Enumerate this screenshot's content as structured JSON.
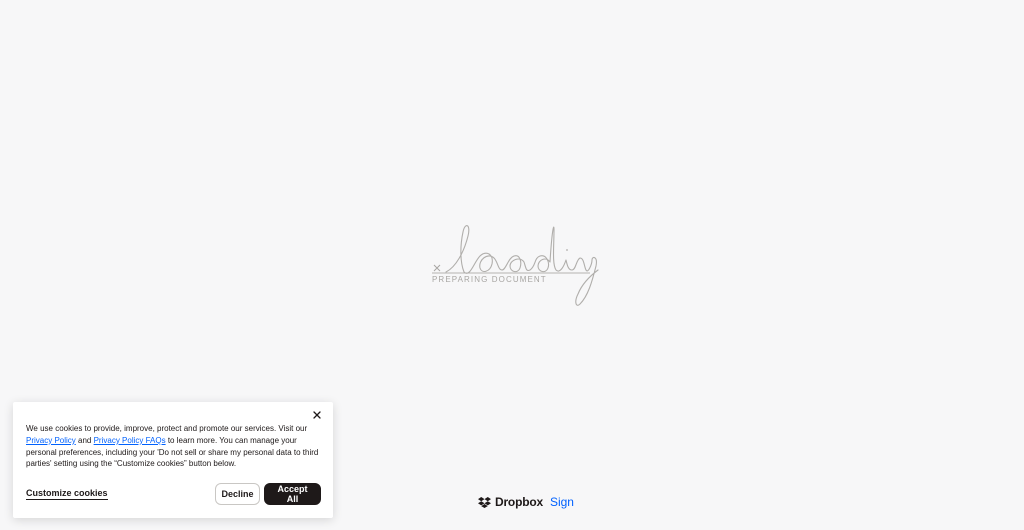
{
  "loading": {
    "script_word": "loading",
    "caption": "PREPARING DOCUMENT"
  },
  "cookie_banner": {
    "text_intro": "We use cookies to provide, improve, protect and promote our services. Visit our ",
    "privacy_policy_link": "Privacy Policy",
    "text_and": " and ",
    "privacy_faq_link": "Privacy Policy FAQs",
    "text_rest": " to learn more. You can manage your personal preferences, including your 'Do not sell or share my personal data to third parties' setting using the “Customize cookies” button below.",
    "customize_label": "Customize cookies",
    "decline_label": "Decline",
    "accept_label": "Accept All",
    "close_icon": "close-icon"
  },
  "brand": {
    "name": "Dropbox",
    "product": "Sign",
    "logo_icon": "dropbox-logo-icon",
    "accent_color": "#0061fe"
  }
}
